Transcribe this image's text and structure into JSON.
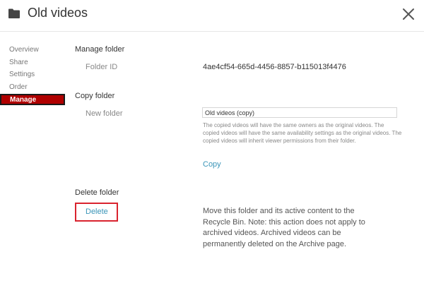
{
  "header": {
    "title": "Old videos",
    "folder_icon": "folder-icon",
    "close_icon": "close-icon"
  },
  "sidebar": {
    "items": [
      {
        "label": "Overview"
      },
      {
        "label": "Share"
      },
      {
        "label": "Settings"
      },
      {
        "label": "Order"
      },
      {
        "label": "Manage",
        "active": true
      }
    ]
  },
  "manage": {
    "title": "Manage folder",
    "folder_id_label": "Folder ID",
    "folder_id_value": "4ae4cf54-665d-4456-8857-b115013f4476"
  },
  "copy": {
    "title": "Copy folder",
    "new_folder_label": "New folder",
    "new_folder_value": "Old videos (copy)",
    "help_text": "The copied videos will have the same owners as the original videos. The copied videos will have the same availability settings as the original videos. The copied videos will inherit viewer permissions from their folder.",
    "copy_label": "Copy"
  },
  "delete": {
    "title": "Delete folder",
    "delete_label": "Delete",
    "description": "Move this folder and its active content to the Recycle Bin. Note: this action does not apply to archived videos. Archived videos can be permanently deleted on the Archive page."
  },
  "colors": {
    "accent_link": "#3a95b8",
    "active_nav": "#b00000",
    "highlight_border": "#d9232e"
  }
}
